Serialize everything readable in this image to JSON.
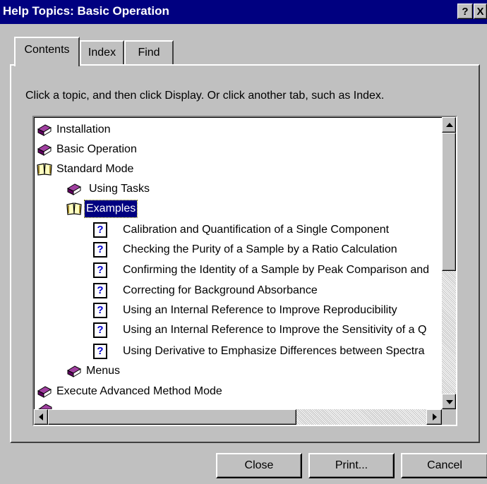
{
  "window": {
    "title": "Help Topics: Basic Operation",
    "help_button": "?",
    "close_button": "X"
  },
  "tabs": [
    {
      "label": "Contents",
      "selected": true
    },
    {
      "label": "Index",
      "selected": false
    },
    {
      "label": "Find",
      "selected": false
    }
  ],
  "instruction": "Click a topic, and then click Display. Or click another tab, such as Index.",
  "tree": {
    "items": [
      {
        "label": "Installation",
        "icon": "closed-book-icon"
      },
      {
        "label": "Basic Operation",
        "icon": "closed-book-icon"
      },
      {
        "label": "Standard Mode",
        "icon": "open-book-icon"
      },
      {
        "label": "Using Tasks",
        "icon": "closed-book-icon"
      },
      {
        "label": "Examples",
        "icon": "open-book-icon",
        "selected": true
      },
      {
        "label": "Calibration and Quantification of a Single Component",
        "icon": "help-topic-icon"
      },
      {
        "label": "Checking the Purity of a Sample by a Ratio Calculation",
        "icon": "help-topic-icon"
      },
      {
        "label": "Confirming the Identity of a Sample by Peak Comparison and",
        "icon": "help-topic-icon"
      },
      {
        "label": "Correcting for Background Absorbance",
        "icon": "help-topic-icon"
      },
      {
        "label": "Using an Internal Reference to Improve Reproducibility",
        "icon": "help-topic-icon"
      },
      {
        "label": "Using an Internal Reference to Improve the Sensitivity of a Q",
        "icon": "help-topic-icon"
      },
      {
        "label": "Using Derivative to Emphasize Differences between Spectra",
        "icon": "help-topic-icon"
      },
      {
        "label": "Menus",
        "icon": "closed-book-icon"
      },
      {
        "label": "Execute Advanced Method Mode",
        "icon": "closed-book-icon"
      }
    ],
    "topic_glyph": "?"
  },
  "buttons": {
    "close": "Close",
    "print": "Print...",
    "cancel": "Cancel"
  },
  "colors": {
    "titlebar": "#000080",
    "face": "#c0c0c0",
    "book": "#800080",
    "selection": "#000080"
  }
}
